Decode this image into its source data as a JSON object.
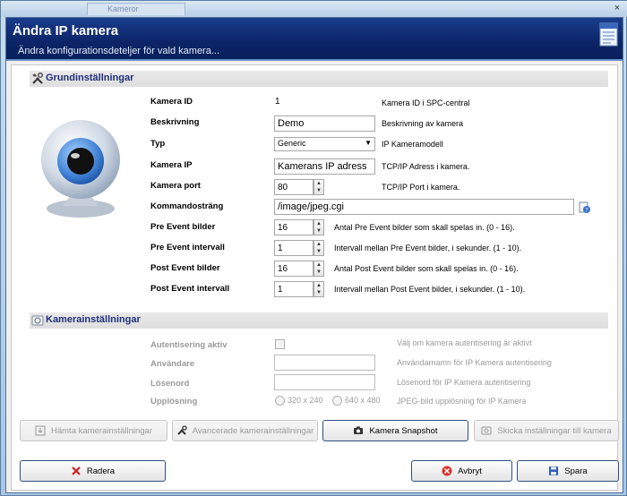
{
  "window": {
    "tab_label": "Kameror",
    "close_label": "×"
  },
  "header": {
    "title": "Ändra IP kamera",
    "subtitle": "Ändra konfigurationsdeteljer för vald kamera..."
  },
  "basic": {
    "section_title": "Grundinställningar",
    "rows": {
      "camera_id": {
        "label": "Kamera ID",
        "value": "1",
        "desc": "Kamera ID i SPC-central"
      },
      "description": {
        "label": "Beskrivning",
        "value": "Demo",
        "desc": "Beskrivning av kamera"
      },
      "type": {
        "label": "Typ",
        "value": "Generic",
        "desc": "IP Kameramodell"
      },
      "camera_ip": {
        "label": "Kamera IP",
        "value": "Kamerans IP adress",
        "desc": "TCP/IP Adress i kamera."
      },
      "camera_port": {
        "label": "Kamera port",
        "value": "80",
        "desc": "TCP/IP Port i kamera."
      },
      "command": {
        "label": "Kommandosträng",
        "value": "/image/jpeg.cgi"
      },
      "pre_event_images": {
        "label": "Pre Event bilder",
        "value": "16",
        "desc": "Antal Pre Event bilder som skall spelas in. (0 - 16)."
      },
      "pre_event_interval": {
        "label": "Pre Event intervall",
        "value": "1",
        "desc": "Intervall mellan Pre Event bilder, i sekunder. (1 - 10)."
      },
      "post_event_images": {
        "label": "Post Event bilder",
        "value": "16",
        "desc": "Antal Post Event bilder som skall spelas in. (0 - 16)."
      },
      "post_event_interval": {
        "label": "Post Event intervall",
        "value": "1",
        "desc": "Intervall mellan Post Event bilder, i sekunder. (1 - 10)."
      }
    }
  },
  "camera_settings": {
    "section_title": "Kamerainställningar",
    "auth": {
      "label": "Autentisering aktiv",
      "checked": false,
      "desc": "Välj om kamera autentisering är aktivt"
    },
    "user": {
      "label": "Användare",
      "value": "",
      "desc": "Användarnamn för IP Kamera autentisering"
    },
    "password": {
      "label": "Lösenord",
      "value": "",
      "desc": "Lösenord för IP Kamera autentisering"
    },
    "resolution": {
      "label": "Upplösning",
      "options": [
        "320 x 240",
        "640 x 480"
      ],
      "desc": "JPEG-bild upplösning för IP Kamera"
    }
  },
  "action_buttons": {
    "fetch": "Hämta kamerainställningar",
    "advanced": "Avancerade kamerainställningar",
    "snapshot": "Kamera Snapshot",
    "send": "Skicka inställningar till kamera"
  },
  "footer": {
    "delete": "Radera",
    "cancel": "Avbryt",
    "save": "Spara"
  },
  "colors": {
    "header_bg": "#0b2466",
    "section_title": "#1f2f7a",
    "disabled_text": "#9a9a9a"
  }
}
